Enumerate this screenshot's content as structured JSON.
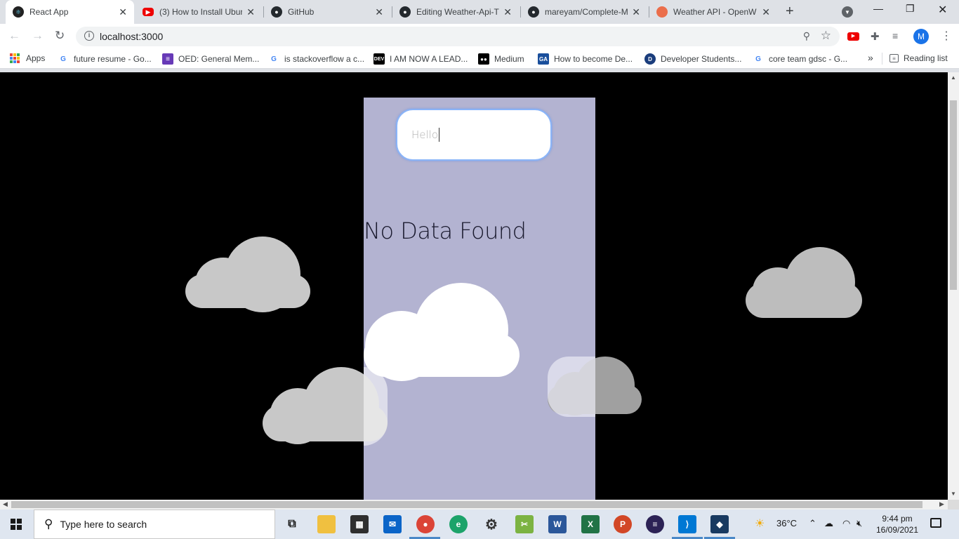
{
  "browser": {
    "tabs": [
      {
        "title": "React App",
        "active": true,
        "icon": "react-icon"
      },
      {
        "title": "(3) How to Install Ubun",
        "icon": "youtube-icon"
      },
      {
        "title": "GitHub",
        "icon": "github-icon"
      },
      {
        "title": "Editing Weather-Api-T",
        "icon": "github-icon"
      },
      {
        "title": "mareyam/Complete-M",
        "icon": "github-icon"
      },
      {
        "title": "Weather API - OpenW",
        "icon": "openweather-icon"
      }
    ],
    "new_tab": "+",
    "address": "localhost:3000",
    "profile_initial": "M",
    "bookmarks": [
      {
        "label": "Apps",
        "icon": "apps-grid-icon"
      },
      {
        "label": "future resume - Go...",
        "icon": "google-icon"
      },
      {
        "label": "OED: General Mem...",
        "icon": "oed-icon"
      },
      {
        "label": "is stackoverflow a c...",
        "icon": "google-icon"
      },
      {
        "label": "I AM NOW A LEAD...",
        "icon": "dev-icon"
      },
      {
        "label": "Medium",
        "icon": "medium-icon"
      },
      {
        "label": "How to become De...",
        "icon": "ga-icon"
      },
      {
        "label": "Developer Students...",
        "icon": "dsc-icon"
      },
      {
        "label": "core team gdsc - G...",
        "icon": "google-icon"
      }
    ],
    "overflow": "»",
    "reading_list": "Reading list"
  },
  "app": {
    "search_value": "Hello",
    "empty_message": "No Data Found"
  },
  "taskbar": {
    "search_placeholder": "Type here to search",
    "temperature": "36°C",
    "time": "9:44 pm",
    "date": "16/09/2021"
  },
  "colors": {
    "page_bg": "#000000",
    "panel_bg": "#b3b3d1",
    "cloud_white": "#ffffff",
    "cloud_gray": "#c8c8c8"
  }
}
